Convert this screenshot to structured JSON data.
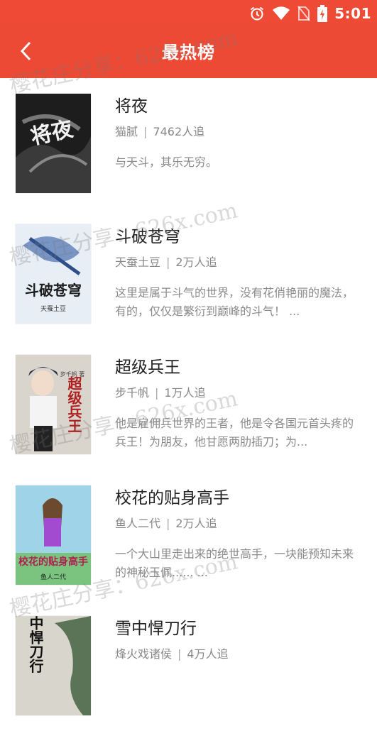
{
  "status_bar": {
    "time": "5:01"
  },
  "header": {
    "title": "最热榜"
  },
  "books": [
    {
      "title": "将夜",
      "author": "猫腻",
      "followers": "7462人追",
      "desc": "与天斗，其乐无穷。"
    },
    {
      "title": "斗破苍穹",
      "author": "天蚕土豆",
      "followers": "2万人追",
      "desc": "这里是属于斗气的世界，没有花俏艳丽的魔法，有的，仅仅是繁衍到巅峰的斗气！ ..."
    },
    {
      "title": "超级兵王",
      "author": "步千帆",
      "followers": "1万人追",
      "desc": "他是雇佣兵世界的王者，他是令各国元首头疼的兵王！为朋友，他甘愿两肋插刀；为..."
    },
    {
      "title": "校花的贴身高手",
      "author": "鱼人二代",
      "followers": "2万人追",
      "desc": "一个大山里走出来的绝世高手，一块能预知未来的神秘玉佩...... ..."
    },
    {
      "title": "雪中悍刀行",
      "author": "烽火戏诸侯",
      "followers": "4万人追",
      "desc": ""
    }
  ],
  "covers": [
    {
      "text": "将夜",
      "sub": "",
      "bg": "#1d1d1d"
    },
    {
      "text": "斗破苍穹",
      "sub": "天蚕土豆",
      "bg": "#e8eef6"
    },
    {
      "text": "超级兵王",
      "sub": "步千帆 著",
      "bg": "#d9d4cc"
    },
    {
      "text": "校花的贴身高手",
      "sub": "鱼人二代",
      "bg": "#9fd4e8"
    },
    {
      "text": "雪中悍刀行",
      "sub": "",
      "bg": "#d8d6cc"
    }
  ],
  "watermark": {
    "text": "樱花庄分享：626x.com"
  },
  "colors": {
    "header": "#ec4a35",
    "title": "#222222",
    "meta": "#888888"
  }
}
